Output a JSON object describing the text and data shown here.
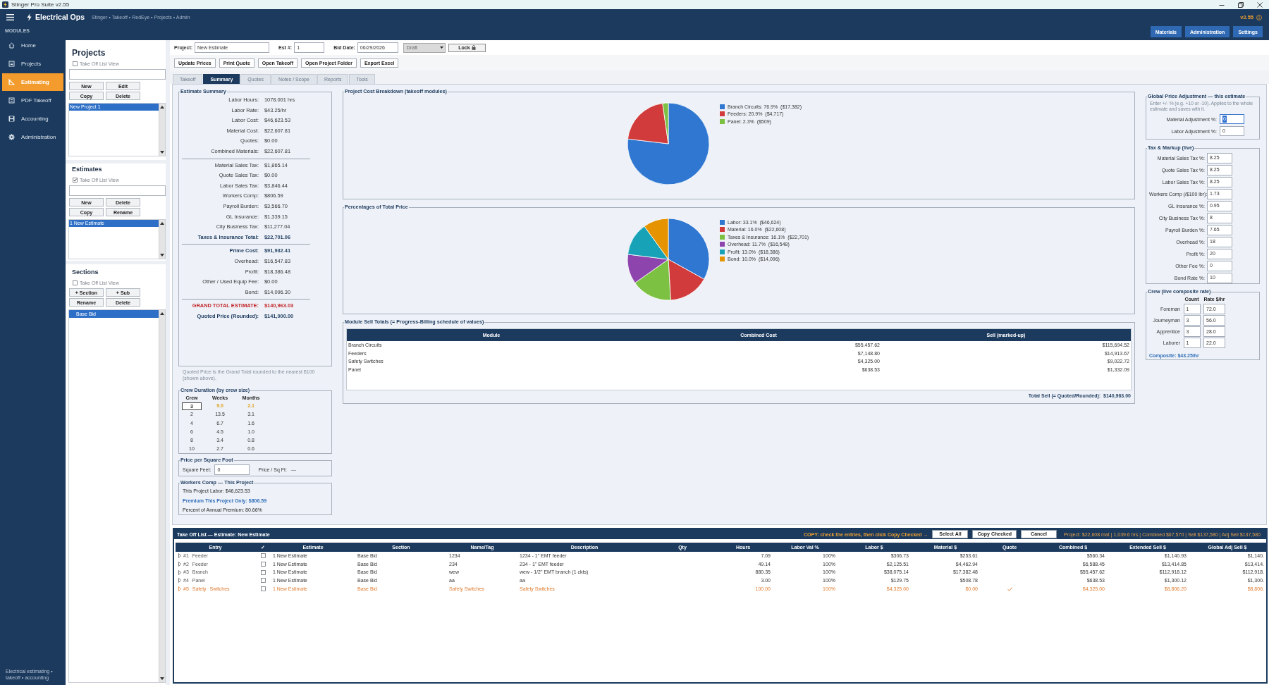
{
  "window": {
    "title": "Stinger Pro Suite v2.55"
  },
  "header": {
    "app_name": "Electrical Ops",
    "breadcrumb": "Stinger • Takeoff • RedEye • Projects • Admin",
    "version": "v2.55",
    "buttons": [
      "Materials",
      "Administration",
      "Settings"
    ]
  },
  "sidebar": {
    "heading": "MODULES",
    "items": [
      {
        "label": "Home",
        "selected": false
      },
      {
        "label": "Projects",
        "selected": false
      },
      {
        "label": "Estimating",
        "selected": true
      },
      {
        "label": "PDF Takeoff",
        "selected": false
      },
      {
        "label": "Accounting",
        "selected": false
      },
      {
        "label": "Administration",
        "selected": false
      }
    ],
    "footer": "Electrical estimating • takeoff • accounting"
  },
  "browser_panels": [
    {
      "title": "Projects",
      "list_view": {
        "label": "Take Off List View",
        "checked": false
      },
      "filter_field": true,
      "buttons": [
        "New",
        "Edit",
        "Copy",
        "Delete"
      ],
      "items": [
        {
          "label": "New Project 1",
          "selected": true
        }
      ]
    },
    {
      "title": "Estimates",
      "list_view": {
        "label": "Take Off List View",
        "checked": true
      },
      "filter_field": true,
      "buttons": [
        "New",
        "Delete",
        "Copy",
        "Rename"
      ],
      "items": [
        {
          "label": "1 New Estimate",
          "selected": true
        }
      ]
    },
    {
      "title": "Sections",
      "list_view": {
        "label": "Take Off List View",
        "checked": false
      },
      "filter_field": false,
      "buttons": [
        "+ Section",
        "+ Sub",
        "Rename",
        "Delete"
      ],
      "items": [
        {
          "label": "Base Bid",
          "selected": true
        }
      ]
    }
  ],
  "project_bar": {
    "fields": [
      {
        "label": "Project:",
        "value": "New Estimate"
      },
      {
        "label": "Est #:",
        "value": "1"
      },
      {
        "label": "Bid Date:",
        "value": "06/29/2026"
      }
    ],
    "status": "Draft",
    "lock": "Lock"
  },
  "toolbar": [
    "Update Prices",
    "Print Quote",
    "Open Takeoff",
    "Open Project Folder",
    "Export Excel"
  ],
  "tabs": [
    {
      "label": "Takeoff",
      "selected": false
    },
    {
      "label": "Summary",
      "selected": true
    },
    {
      "label": "Quotes",
      "selected": false
    },
    {
      "label": "Notes / Scope",
      "selected": false
    },
    {
      "label": "Reports",
      "selected": false
    },
    {
      "label": "Tools",
      "selected": false
    }
  ],
  "estimate_summary": {
    "title": "Estimate Summary",
    "groups": [
      {
        "rows": [
          {
            "label": "Labor Hours:",
            "value": "1078.001 hrs",
            "kind": "plain"
          },
          {
            "label": "Labor Rate:",
            "value": "$43.25/hr",
            "kind": "plain"
          },
          {
            "label": "Labor Cost:",
            "value": "$46,623.53",
            "kind": "plain"
          },
          {
            "label": "Material Cost:",
            "value": "$22,607.81",
            "kind": "plain"
          },
          {
            "label": "Quotes:",
            "value": "$0.00",
            "kind": "plain"
          },
          {
            "label": "Combined Materials:",
            "value": "$22,607.81",
            "kind": "plain"
          }
        ]
      },
      {
        "rows": [
          {
            "label": "Material Sales Tax:",
            "value": "$1,865.14",
            "kind": "plain"
          },
          {
            "label": "Quote Sales Tax:",
            "value": "$0.00",
            "kind": "plain"
          },
          {
            "label": "Labor Sales Tax:",
            "value": "$3,846.44",
            "kind": "plain"
          },
          {
            "label": "Workers Comp:",
            "value": "$806.59",
            "kind": "plain"
          },
          {
            "label": "Payroll Burden:",
            "value": "$3,566.70",
            "kind": "plain"
          },
          {
            "label": "GL Insurance:",
            "value": "$1,339.15",
            "kind": "plain"
          },
          {
            "label": "City Business Tax:",
            "value": "$11,277.04",
            "kind": "plain"
          },
          {
            "label": "Taxes & Insurance Total:",
            "value": "$22,701.06",
            "kind": "total"
          }
        ]
      },
      {
        "rows": [
          {
            "label": "Prime Cost:",
            "value": "$91,932.41",
            "kind": "total"
          },
          {
            "label": "Overhead:",
            "value": "$16,547.83",
            "kind": "plain"
          },
          {
            "label": "Profit:",
            "value": "$18,386.48",
            "kind": "plain"
          },
          {
            "label": "Other / Used Equip Fee:",
            "value": "$0.00",
            "kind": "plain"
          },
          {
            "label": "Bond:",
            "value": "$14,096.30",
            "kind": "plain"
          }
        ]
      },
      {
        "rows": [
          {
            "label": "GRAND TOTAL ESTIMATE:",
            "value": "$140,963.03",
            "kind": "grand"
          },
          {
            "label": "Quoted Price (Rounded):",
            "value": "$141,000.00",
            "kind": "total"
          }
        ]
      }
    ],
    "note": "Quoted Price is the Grand Total rounded to the nearest $100 (shown above)."
  },
  "crew_duration": {
    "title": "Crew Duration (by crew size)",
    "columns": [
      "Crew",
      "Weeks",
      "Months"
    ],
    "rows": [
      {
        "crew": "3",
        "weeks": "9.0",
        "months": "2.1",
        "selected": true
      },
      {
        "crew": "2",
        "weeks": "13.5",
        "months": "3.1",
        "selected": false
      },
      {
        "crew": "4",
        "weeks": "6.7",
        "months": "1.6",
        "selected": false
      },
      {
        "crew": "6",
        "weeks": "4.5",
        "months": "1.0",
        "selected": false
      },
      {
        "crew": "8",
        "weeks": "3.4",
        "months": "0.8",
        "selected": false
      },
      {
        "crew": "10",
        "weeks": "2.7",
        "months": "0.6",
        "selected": false
      }
    ]
  },
  "price_per_sqft": {
    "title": "Price per Square Foot",
    "square_feet_label": "Square Feet:",
    "square_feet": "0",
    "price_label": "Price / Sq Ft:",
    "price": "—"
  },
  "workers_comp": {
    "title": "Workers Comp — This Project",
    "lines": [
      {
        "text": "This Project Labor: $46,623.53",
        "kind": "plain"
      },
      {
        "text": "Premium This Project Only: $806.59",
        "kind": "highlight"
      },
      {
        "text": "Percent of Annual Premium: 80.66%",
        "kind": "plain"
      }
    ]
  },
  "charts": [
    {
      "chart_data": {
        "type": "pie",
        "title": "Project Cost Breakdown (takeoff modules)",
        "legend": "right",
        "categories": [
          "Branch Circuits: 76.9%  ($17,382)",
          "Feeders: 20.9%  ($4,717)",
          "Panel: 2.3%  ($509)"
        ],
        "values": [
          17382,
          4717,
          509
        ],
        "colors": [
          "#2f77d1",
          "#d13b3b",
          "#7cc142"
        ]
      }
    },
    {
      "chart_data": {
        "type": "pie",
        "title": "Percentages of Total Price",
        "legend": "right",
        "categories": [
          "Labor: 33.1%  ($46,624)",
          "Material: 16.0%  ($22,608)",
          "Taxes & Insurance: 16.1%  ($22,701)",
          "Overhead: 11.7%  ($16,548)",
          "Profit: 13.0%  ($18,386)",
          "Bond: 10.0%  ($14,096)"
        ],
        "values": [
          46624,
          22608,
          22701,
          16548,
          18386,
          14096
        ],
        "colors": [
          "#2f77d1",
          "#d13b3b",
          "#7cc142",
          "#8e44ad",
          "#17a2b8",
          "#e59400"
        ]
      }
    }
  ],
  "module_totals": {
    "title": "Module Sell Totals  (= Progress-Billing schedule of values)",
    "columns": [
      "Module",
      "Combined Cost",
      "Sell (marked-up)"
    ],
    "rows": [
      {
        "module": "Branch Circuits",
        "combined_cost": "$55,457.62",
        "sell": "$115,694.52"
      },
      {
        "module": "Feeders",
        "combined_cost": "$7,148.80",
        "sell": "$14,913.67"
      },
      {
        "module": "Safety Switches",
        "combined_cost": "$4,325.00",
        "sell": "$9,022.72"
      },
      {
        "module": "Panel",
        "combined_cost": "$638.53",
        "sell": "$1,332.09"
      }
    ],
    "total": "Total Sell (= Quoted/Rounded):  $140,963.00"
  },
  "global_adjustment": {
    "title": "Global Price Adjustment — this estimate",
    "hint": "Enter +/- % (e.g. +10 or -10). Applies to the whole estimate and saves with it.",
    "fields": [
      {
        "label": "Material Adjustment %:",
        "value": "0",
        "focused": true
      },
      {
        "label": "Labor Adjustment %:",
        "value": "0",
        "focused": false
      }
    ]
  },
  "tax_markup": {
    "title": "Tax & Markup (live)",
    "fields": [
      {
        "label": "Material Sales Tax %:",
        "value": "8.25"
      },
      {
        "label": "Quote Sales Tax %:",
        "value": "8.25"
      },
      {
        "label": "Labor Sales Tax %:",
        "value": "8.25"
      },
      {
        "label": "Workers Comp (/$100 lbr):",
        "value": "1.73"
      },
      {
        "label": "GL Insurance %:",
        "value": "0.95"
      },
      {
        "label": "City Business Tax %:",
        "value": "8"
      },
      {
        "label": "Payroll Burden %:",
        "value": "7.65"
      },
      {
        "label": "Overhead %:",
        "value": "18"
      },
      {
        "label": "Profit %:",
        "value": "20"
      },
      {
        "label": "Other Fee %:",
        "value": "0"
      },
      {
        "label": "Bond Rate %:",
        "value": "10"
      }
    ]
  },
  "crew": {
    "title": "Crew (live composite rate)",
    "columns": [
      "Count",
      "Rate $/hr"
    ],
    "rows": [
      {
        "role": "Foreman",
        "count": "1",
        "rate": "72.0"
      },
      {
        "role": "Journeyman",
        "count": "3",
        "rate": "56.0"
      },
      {
        "role": "Apprentice",
        "count": "3",
        "rate": "28.0"
      },
      {
        "role": "Laborer",
        "count": "1",
        "rate": "22.0"
      }
    ],
    "composite": "Composite: $43.25/hr"
  },
  "takeoff_list": {
    "title": "Take Off List — Estimate: New Estimate",
    "copy_hint": "COPY: check the entries, then click Copy Checked →",
    "buttons": [
      "Select All",
      "Copy Checked",
      "Cancel"
    ],
    "summary": "Project: $22,608 mat | 1,039.6 hrs | Combined $67,570 | Sell $137,580 | Adj Sell $137,580",
    "columns": [
      "Entry",
      "✓",
      "Estimate",
      "Section",
      "Name/Tag",
      "Description",
      "Qty",
      "Hours",
      "Labor Val %",
      "Labor $",
      "Material $",
      "Quote",
      "Combined $",
      "Extended Sell $",
      "Global Adj Sell $"
    ],
    "rows": [
      {
        "entry": "#1 Feeder",
        "checked": false,
        "estimate": "1 New Estimate",
        "section": "Base Bid",
        "name_tag": "1234",
        "description": "1234 - 1\" EMT feeder",
        "hours": "7.09",
        "labor_val": "100%",
        "labor": "$306.73",
        "material": "$253.61",
        "quote": false,
        "combined": "$560.34",
        "extended_sell": "$1,140.93",
        "global_adj_sell": "$1,140."
      },
      {
        "entry": "#2 Feeder",
        "checked": false,
        "estimate": "1 New Estimate",
        "section": "Base Bid",
        "name_tag": "234",
        "description": "234 - 1\" EMT feeder",
        "hours": "49.14",
        "labor_val": "100%",
        "labor": "$2,125.51",
        "material": "$4,462.94",
        "quote": false,
        "combined": "$6,588.45",
        "extended_sell": "$13,414.85",
        "global_adj_sell": "$13,414."
      },
      {
        "entry": "#3 Branch",
        "checked": false,
        "estimate": "1 New Estimate",
        "section": "Base Bid",
        "name_tag": "wew",
        "description": "wew - 1/2\" EMT branch (1 ckts)",
        "hours": "880.35",
        "labor_val": "100%",
        "labor": "$38,075.14",
        "material": "$17,382.48",
        "quote": false,
        "combined": "$55,457.62",
        "extended_sell": "$112,918.12",
        "global_adj_sell": "$112,918."
      },
      {
        "entry": "#4 Panel",
        "checked": false,
        "estimate": "1 New Estimate",
        "section": "Base Bid",
        "name_tag": "aa",
        "description": "aa",
        "hours": "3.00",
        "labor_val": "100%",
        "labor": "$129.75",
        "material": "$508.78",
        "quote": false,
        "combined": "$638.53",
        "extended_sell": "$1,300.12",
        "global_adj_sell": "$1,300."
      },
      {
        "entry": "#5 Safety Switches",
        "checked": false,
        "estimate": "1 New Estimate",
        "section": "Base Bid",
        "name_tag": "Safety Switches",
        "description": "Safety Switches",
        "hours": "100.00",
        "labor_val": "100%",
        "labor": "$4,325.00",
        "material": "$0.00",
        "quote": true,
        "combined": "$4,325.00",
        "extended_sell": "$8,806.20",
        "global_adj_sell": "$8,806."
      }
    ]
  }
}
